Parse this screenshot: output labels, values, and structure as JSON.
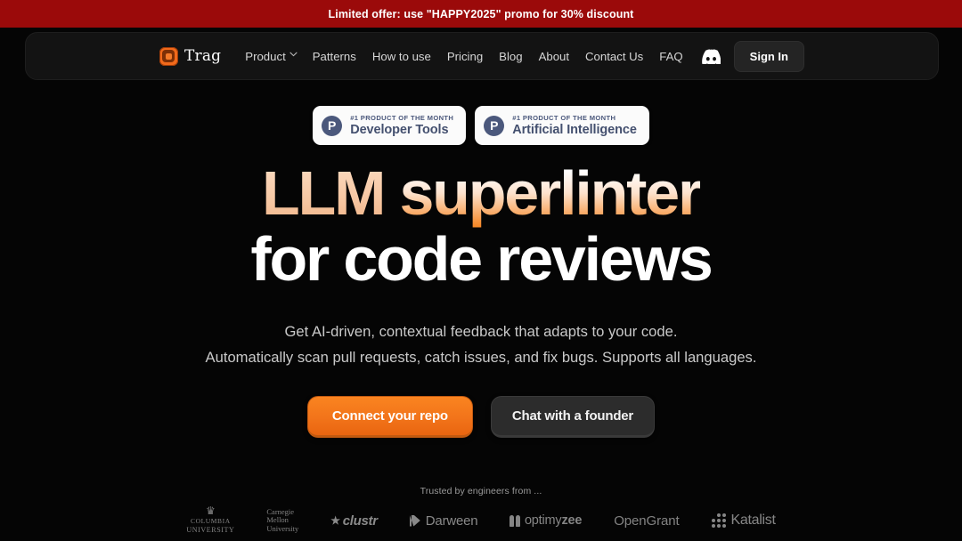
{
  "promo": {
    "text": "Limited offer: use \"HAPPY2025\" promo for 30% discount",
    "bg_color": "#9b0a0a"
  },
  "nav": {
    "brand": "Trag",
    "brand_icon": "trag-logo-icon",
    "links": [
      {
        "label": "Product",
        "has_dropdown": true
      },
      {
        "label": "Patterns",
        "has_dropdown": false
      },
      {
        "label": "How to use",
        "has_dropdown": false
      },
      {
        "label": "Pricing",
        "has_dropdown": false
      },
      {
        "label": "Blog",
        "has_dropdown": false
      },
      {
        "label": "About",
        "has_dropdown": false
      },
      {
        "label": "Contact Us",
        "has_dropdown": false
      },
      {
        "label": "FAQ",
        "has_dropdown": false
      }
    ],
    "discord_icon": "discord-icon",
    "signin_label": "Sign In"
  },
  "badges": [
    {
      "kicker": "#1 PRODUCT OF THE MONTH",
      "title": "Developer Tools",
      "icon_letter": "P"
    },
    {
      "kicker": "#1 PRODUCT OF THE MONTH",
      "title": "Artificial Intelligence",
      "icon_letter": "P"
    }
  ],
  "hero": {
    "headline_part1": "LLM ",
    "headline_part2": "superlinter",
    "headline_line2": "for code reviews",
    "subtitle_line1": "Get AI-driven, contextual feedback that adapts to your code.",
    "subtitle_line2": "Automatically scan pull requests, catch issues, and fix bugs. Supports all languages.",
    "cta_primary": "Connect your repo",
    "cta_secondary": "Chat with a founder",
    "accent_color": "#f2741a"
  },
  "trusted": {
    "label": "Trusted by engineers from ...",
    "logos": [
      {
        "name": "Columbia University",
        "line1": "COLUMBIA",
        "line2": "UNIVERSITY"
      },
      {
        "name": "Carnegie Mellon University",
        "line1": "Carnegie",
        "line2": "Mellon",
        "line3": "University"
      },
      {
        "name": "clustr",
        "text": "clustr"
      },
      {
        "name": "Darween",
        "text": "Darween"
      },
      {
        "name": "optimyzee",
        "text": "optimy",
        "text_bold": "zee"
      },
      {
        "name": "OpenGrant",
        "text": "OpenGrant"
      },
      {
        "name": "Katalist",
        "text": "Katalist"
      }
    ]
  }
}
